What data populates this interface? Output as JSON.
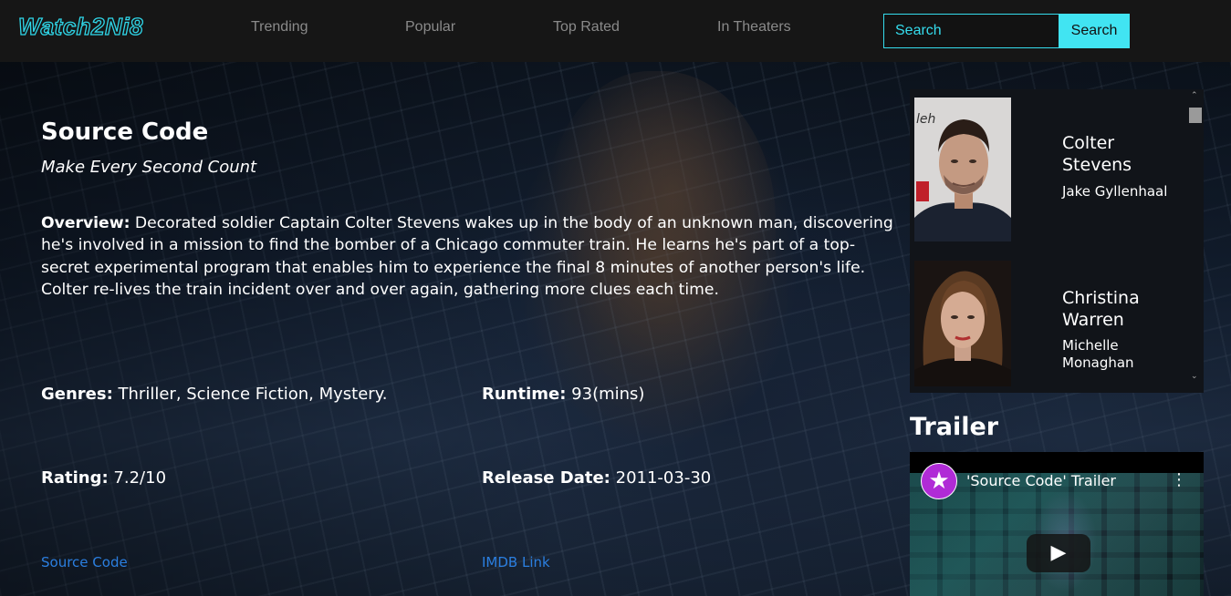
{
  "nav": {
    "logo": "Watch2Ni8",
    "links": [
      "Trending",
      "Popular",
      "Top Rated",
      "In Theaters"
    ],
    "search_placeholder": "Search",
    "search_button": "Search"
  },
  "movie": {
    "title": "Source Code",
    "tagline": "Make Every Second Count",
    "overview_label": "Overview:",
    "overview": "Decorated soldier Captain Colter Stevens wakes up in the body of an unknown man, discovering he's involved in a mission to find the bomber of a Chicago commuter train. He learns he's part of a top-secret experimental program that enables him to experience the final 8 minutes of another person's life. Colter re-lives the train incident over and over again, gathering more clues each time.",
    "genres_label": "Genres:",
    "genres": "Thriller, Science Fiction, Mystery.",
    "runtime_label": "Runtime:",
    "runtime": "93(mins)",
    "rating_label": "Rating:",
    "rating": "7.2/10",
    "release_label": "Release Date:",
    "release_date": "2011-03-30",
    "homepage_link": "Source Code",
    "imdb_link": "IMDB Link"
  },
  "cast": [
    {
      "character_line1": "Colter",
      "character_line2": "Stevens",
      "actor_line1": "Jake Gyllenhaal",
      "actor_line2": ""
    },
    {
      "character_line1": "Christina",
      "character_line2": "Warren",
      "actor_line1": "Michelle",
      "actor_line2": "Monaghan"
    }
  ],
  "trailer": {
    "heading": "Trailer",
    "video_title": "'Source Code' Trailer"
  },
  "colors": {
    "accent": "#41e4f2",
    "link": "#2b7fe0",
    "navbar": "#161616"
  }
}
